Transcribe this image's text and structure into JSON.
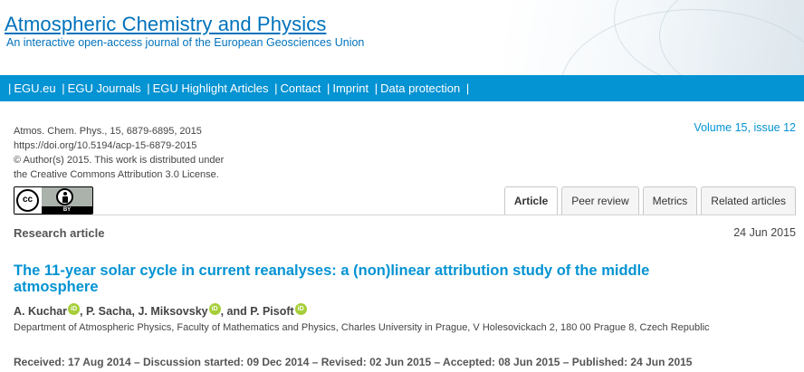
{
  "header": {
    "title": "Atmospheric Chemistry and Physics",
    "subtitle": "An interactive open-access journal of the European Geosciences Union"
  },
  "nav": {
    "items": [
      {
        "label": "EGU.eu"
      },
      {
        "label": "EGU Journals"
      },
      {
        "label": "EGU Highlight Articles"
      },
      {
        "label": "Contact"
      },
      {
        "label": "Imprint"
      },
      {
        "label": "Data protection"
      }
    ],
    "separator": "|"
  },
  "meta": {
    "citation": "Atmos. Chem. Phys., 15, 6879-6895, 2015",
    "doi": "https://doi.org/10.5194/acp-15-6879-2015",
    "copyright": "© Author(s) 2015. This work is distributed under",
    "license": "the Creative Commons Attribution 3.0 License.",
    "badge_cc": "cc",
    "badge_by": "BY"
  },
  "volume_link": "Volume 15, issue 12",
  "tabs": [
    {
      "label": "Article",
      "active": true
    },
    {
      "label": "Peer review",
      "active": false
    },
    {
      "label": "Metrics",
      "active": false
    },
    {
      "label": "Related articles",
      "active": false
    }
  ],
  "article": {
    "type": "Research article",
    "date": "24 Jun 2015",
    "title_line1": "The 11-year solar cycle in current reanalyses: a (non)linear attribution study of the middle",
    "title_line2": "atmosphere",
    "authors": [
      {
        "name": "A. Kuchar",
        "orcid": true
      },
      {
        "name": "P. Sacha",
        "orcid": false
      },
      {
        "name": "J. Miksovsky",
        "orcid": true
      },
      {
        "name": "P. Pisoft",
        "orcid": true
      }
    ],
    "author_sep_1": ", ",
    "author_sep_2": ", ",
    "author_sep_3": ", and ",
    "orcid_label": "iD",
    "affiliation": "Department of Atmospheric Physics, Faculty of Mathematics and Physics, Charles University in Prague, V Holesovickach 2, 180 00 Prague 8, Czech Republic",
    "history": "Received: 17 Aug 2014 – Discussion started: 09 Dec 2014 – Revised: 02 Jun 2015 – Accepted: 08 Jun 2015 – Published: 24 Jun 2015"
  },
  "colors": {
    "brand": "#0072bc",
    "nav_bg": "#0493d3",
    "orcid": "#a6ce39"
  }
}
